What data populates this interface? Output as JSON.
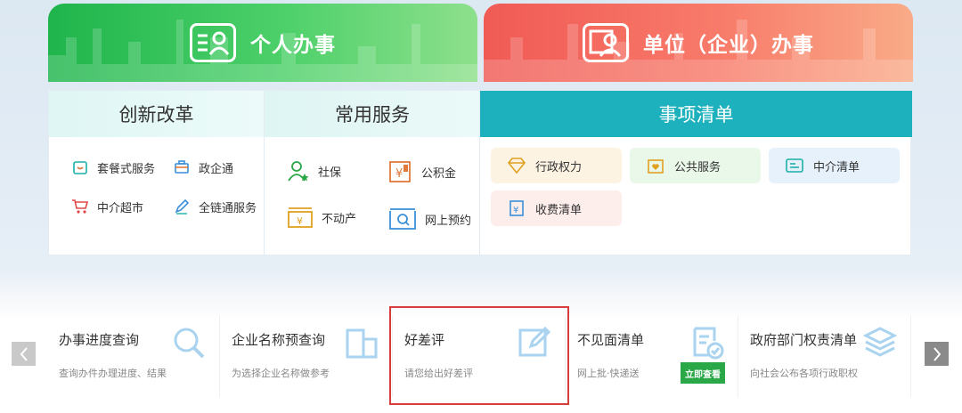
{
  "banners": {
    "personal": "个人办事",
    "company": "单位（企业）办事"
  },
  "columns": {
    "reform": {
      "title": "创新改革",
      "items": [
        "套餐式服务",
        "政企通",
        "中介超市",
        "全链通服务"
      ]
    },
    "common": {
      "title": "常用服务",
      "items": [
        "社保",
        "公积金",
        "不动产",
        "网上预约"
      ]
    },
    "list": {
      "title": "事项清单",
      "items": [
        "行政权力",
        "公共服务",
        "中介清单",
        "收费清单"
      ]
    }
  },
  "cards": [
    {
      "title": "办事进度查询",
      "desc": "查询办件办理进度、结果",
      "icon": "search-icon"
    },
    {
      "title": "企业名称预查询",
      "desc": "为选择企业名称做参考",
      "icon": "building-icon"
    },
    {
      "title": "好差评",
      "desc": "请您给出好差评",
      "icon": "edit-icon"
    },
    {
      "title": "不见面清单",
      "desc": "网上批·快递送",
      "icon": "document-check-icon",
      "button": "立即查看"
    },
    {
      "title": "政府部门权责清单",
      "desc": "向社会公布各项行政职权",
      "icon": "layers-icon"
    }
  ],
  "colors": {
    "personal_green": "#1fb54c",
    "company_red": "#f05a55",
    "teal_header": "#1db1bd",
    "highlight_red": "#d83d3d",
    "view_button_green": "#2aa746"
  }
}
